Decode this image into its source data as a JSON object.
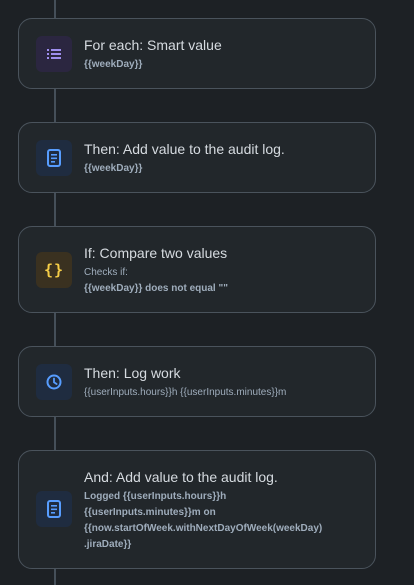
{
  "steps": [
    {
      "title": "For each: Smart value",
      "detail": "{{weekDay}}",
      "icon": "list-icon"
    },
    {
      "title": "Then: Add value to the audit log.",
      "detail": "{{weekDay}}",
      "icon": "document-icon"
    },
    {
      "title": "If: Compare two values",
      "label": "Checks if:",
      "detail": "{{weekDay}} does not equal \"\"",
      "icon": "curly-braces-icon"
    },
    {
      "title": "Then: Log work",
      "detail": "{{userInputs.hours}}h {{userInputs.minutes}}m",
      "icon": "clock-icon"
    },
    {
      "title": "And: Add value to the audit log.",
      "detail_lines": [
        "Logged {{userInputs.hours}}h",
        "{{userInputs.minutes}}m on",
        "{{now.startOfWeek.withNextDayOfWeek(weekDay)",
        ".jiraDate}}"
      ],
      "icon": "document-icon"
    }
  ],
  "colors": {
    "background": "#1d2125",
    "card": "#22272b",
    "purple_icon": "#9f8fef",
    "blue_icon": "#579dff",
    "yellow_icon": "#f5cd47"
  }
}
